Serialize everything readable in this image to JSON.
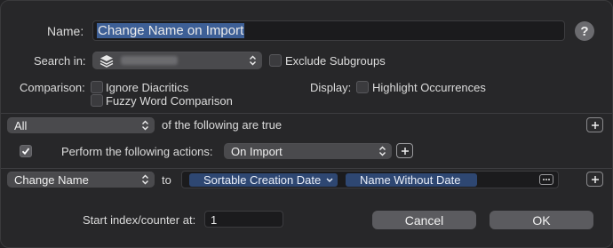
{
  "name_label": "Name:",
  "name_value": "Change Name on Import",
  "help": "?",
  "search_label": "Search in:",
  "exclude_subgroups": "Exclude Subgroups",
  "comparison_label": "Comparison:",
  "ignore_diacritics": "Ignore Diacritics",
  "fuzzy_word": "Fuzzy Word Comparison",
  "display_label": "Display:",
  "highlight_occurrences": "Highlight Occurrences",
  "match_mode": "All",
  "match_suffix": "of the following are true",
  "perform_label": "Perform the following actions:",
  "trigger": "On Import",
  "action": "Change Name",
  "to_label": "to",
  "token_1": "Sortable Creation Date",
  "token_2": "Name Without Date",
  "start_index_label": "Start index/counter at:",
  "start_index_value": "1",
  "cancel": "Cancel",
  "ok": "OK",
  "colors": {
    "token": "#2e4772",
    "button": "#5b5b5f",
    "background": "#272729"
  }
}
